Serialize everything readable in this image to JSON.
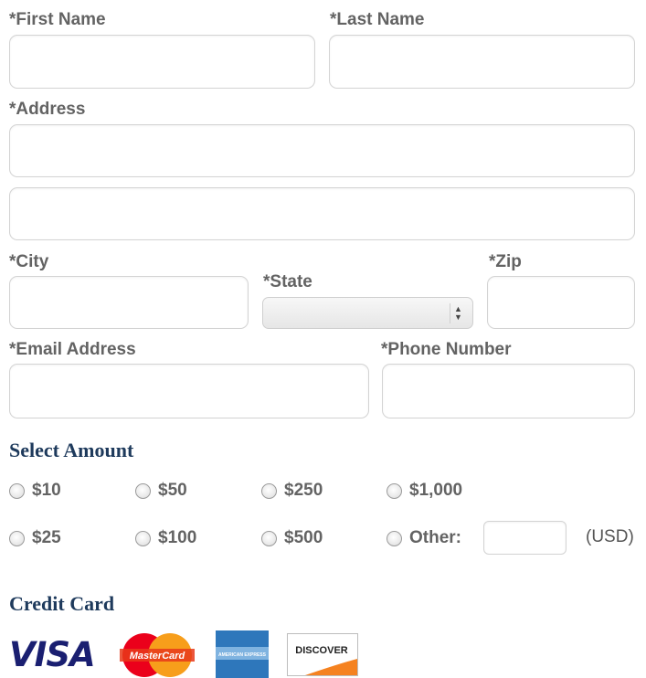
{
  "form": {
    "first_name_label": "*First Name",
    "last_name_label": "*Last Name",
    "address_label": "*Address",
    "city_label": "*City",
    "state_label": "*State",
    "zip_label": "*Zip",
    "email_label": "*Email Address",
    "phone_label": "*Phone Number",
    "state_selected": ""
  },
  "amount": {
    "heading": "Select Amount",
    "options": [
      "$10",
      "$50",
      "$250",
      "$1,000",
      "$25",
      "$100",
      "$500",
      "Other:"
    ],
    "currency_note": "(USD)"
  },
  "credit_card": {
    "heading": "Credit Card",
    "cards": [
      {
        "name": "visa",
        "text": "VISA",
        "color": "#1a1f71"
      },
      {
        "name": "mastercard",
        "text": "MasterCard",
        "colors": [
          "#eb001b",
          "#f79e1b"
        ]
      },
      {
        "name": "american-express",
        "text": "AMERICAN EXPRESS",
        "color": "#2e77bb"
      },
      {
        "name": "discover",
        "text": "DISCOVER",
        "color": "#f58220"
      }
    ]
  }
}
